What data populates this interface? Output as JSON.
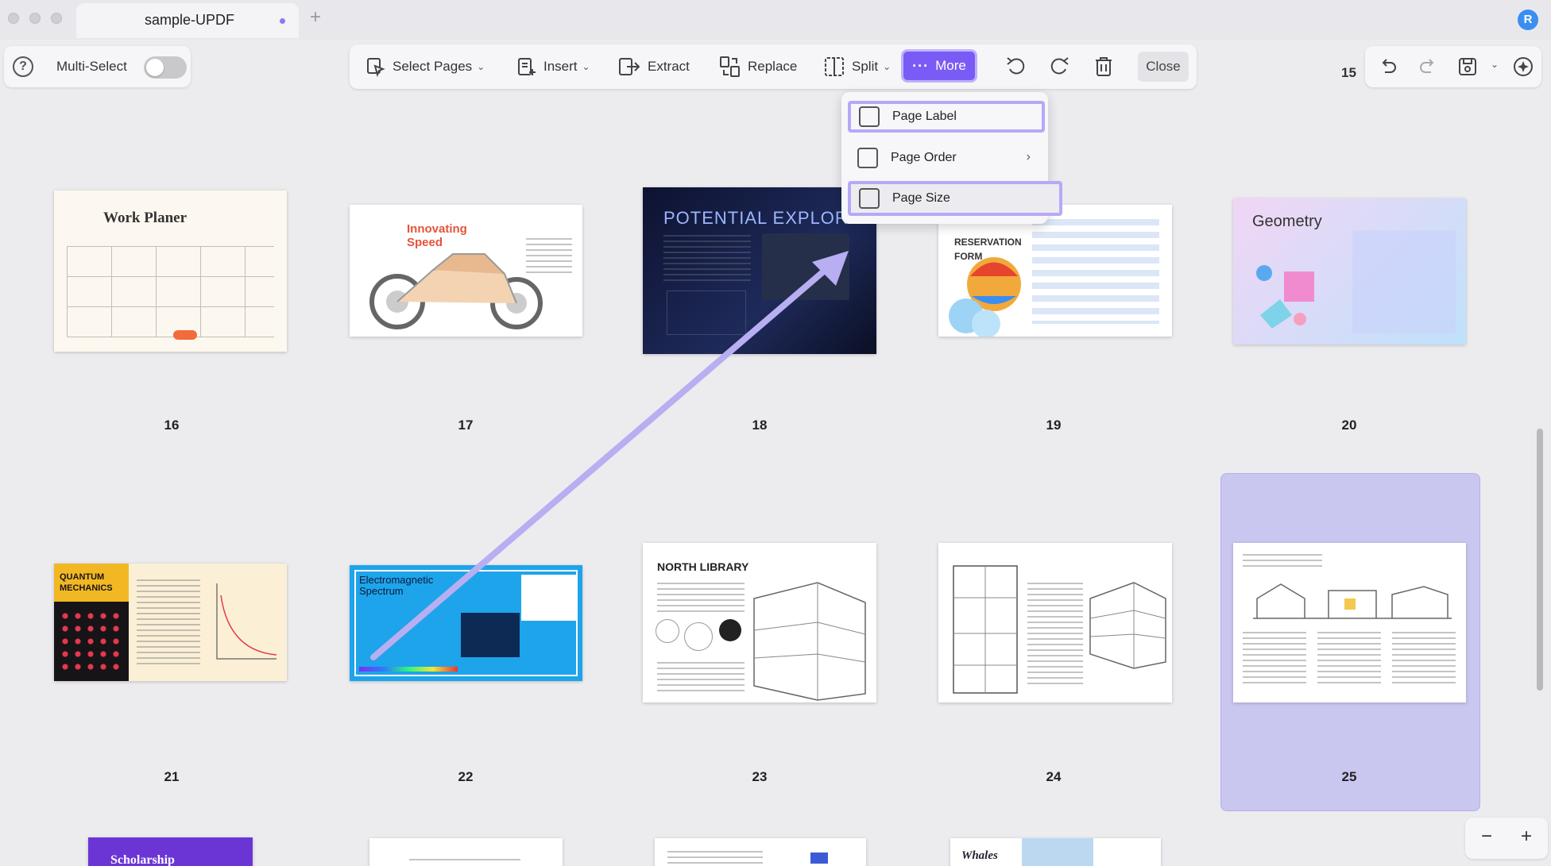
{
  "window": {
    "tab_title": "sample-UPDF",
    "user_initial": "R",
    "new_tab_symbol": "+"
  },
  "left_panel": {
    "help_symbol": "?",
    "multi_select_label": "Multi-Select",
    "multi_select_on": false
  },
  "toolbar": {
    "select_pages": "Select Pages",
    "insert": "Insert",
    "extract": "Extract",
    "replace": "Replace",
    "split": "Split",
    "more": "More",
    "close": "Close",
    "icons": [
      "rotate-left-icon",
      "rotate-right-icon",
      "trash-icon"
    ]
  },
  "page_count": "15",
  "more_menu": {
    "items": [
      {
        "label": "Page Label",
        "has_submenu": false,
        "highlighted": true
      },
      {
        "label": "Page Order",
        "has_submenu": true,
        "highlighted": false
      },
      {
        "label": "Page Size",
        "has_submenu": false,
        "highlighted": true
      }
    ]
  },
  "pages": [
    {
      "number": "16",
      "title": "Work Planer"
    },
    {
      "number": "17",
      "title": "Innovating Speed"
    },
    {
      "number": "18",
      "title": "POTENTIAL EXPLORATION"
    },
    {
      "number": "19",
      "title": "RESERVATION FORM"
    },
    {
      "number": "20",
      "title": "Geometry"
    },
    {
      "number": "21",
      "title": "QUANTUM MECHANICS"
    },
    {
      "number": "22",
      "title": "Electromagnetic Spectrum"
    },
    {
      "number": "23",
      "title": "NORTH LIBRARY"
    },
    {
      "number": "24",
      "title": ""
    },
    {
      "number": "25",
      "title": "",
      "selected": true
    }
  ],
  "bottom_partial_titles": [
    "Scholarship",
    "",
    "",
    "Whales"
  ],
  "zoom": {
    "out": "−",
    "in": "+"
  },
  "colors": {
    "accent": "#7b5bf5",
    "selection": "#c9c6f0",
    "highlight_border": "#b7a8f8"
  }
}
